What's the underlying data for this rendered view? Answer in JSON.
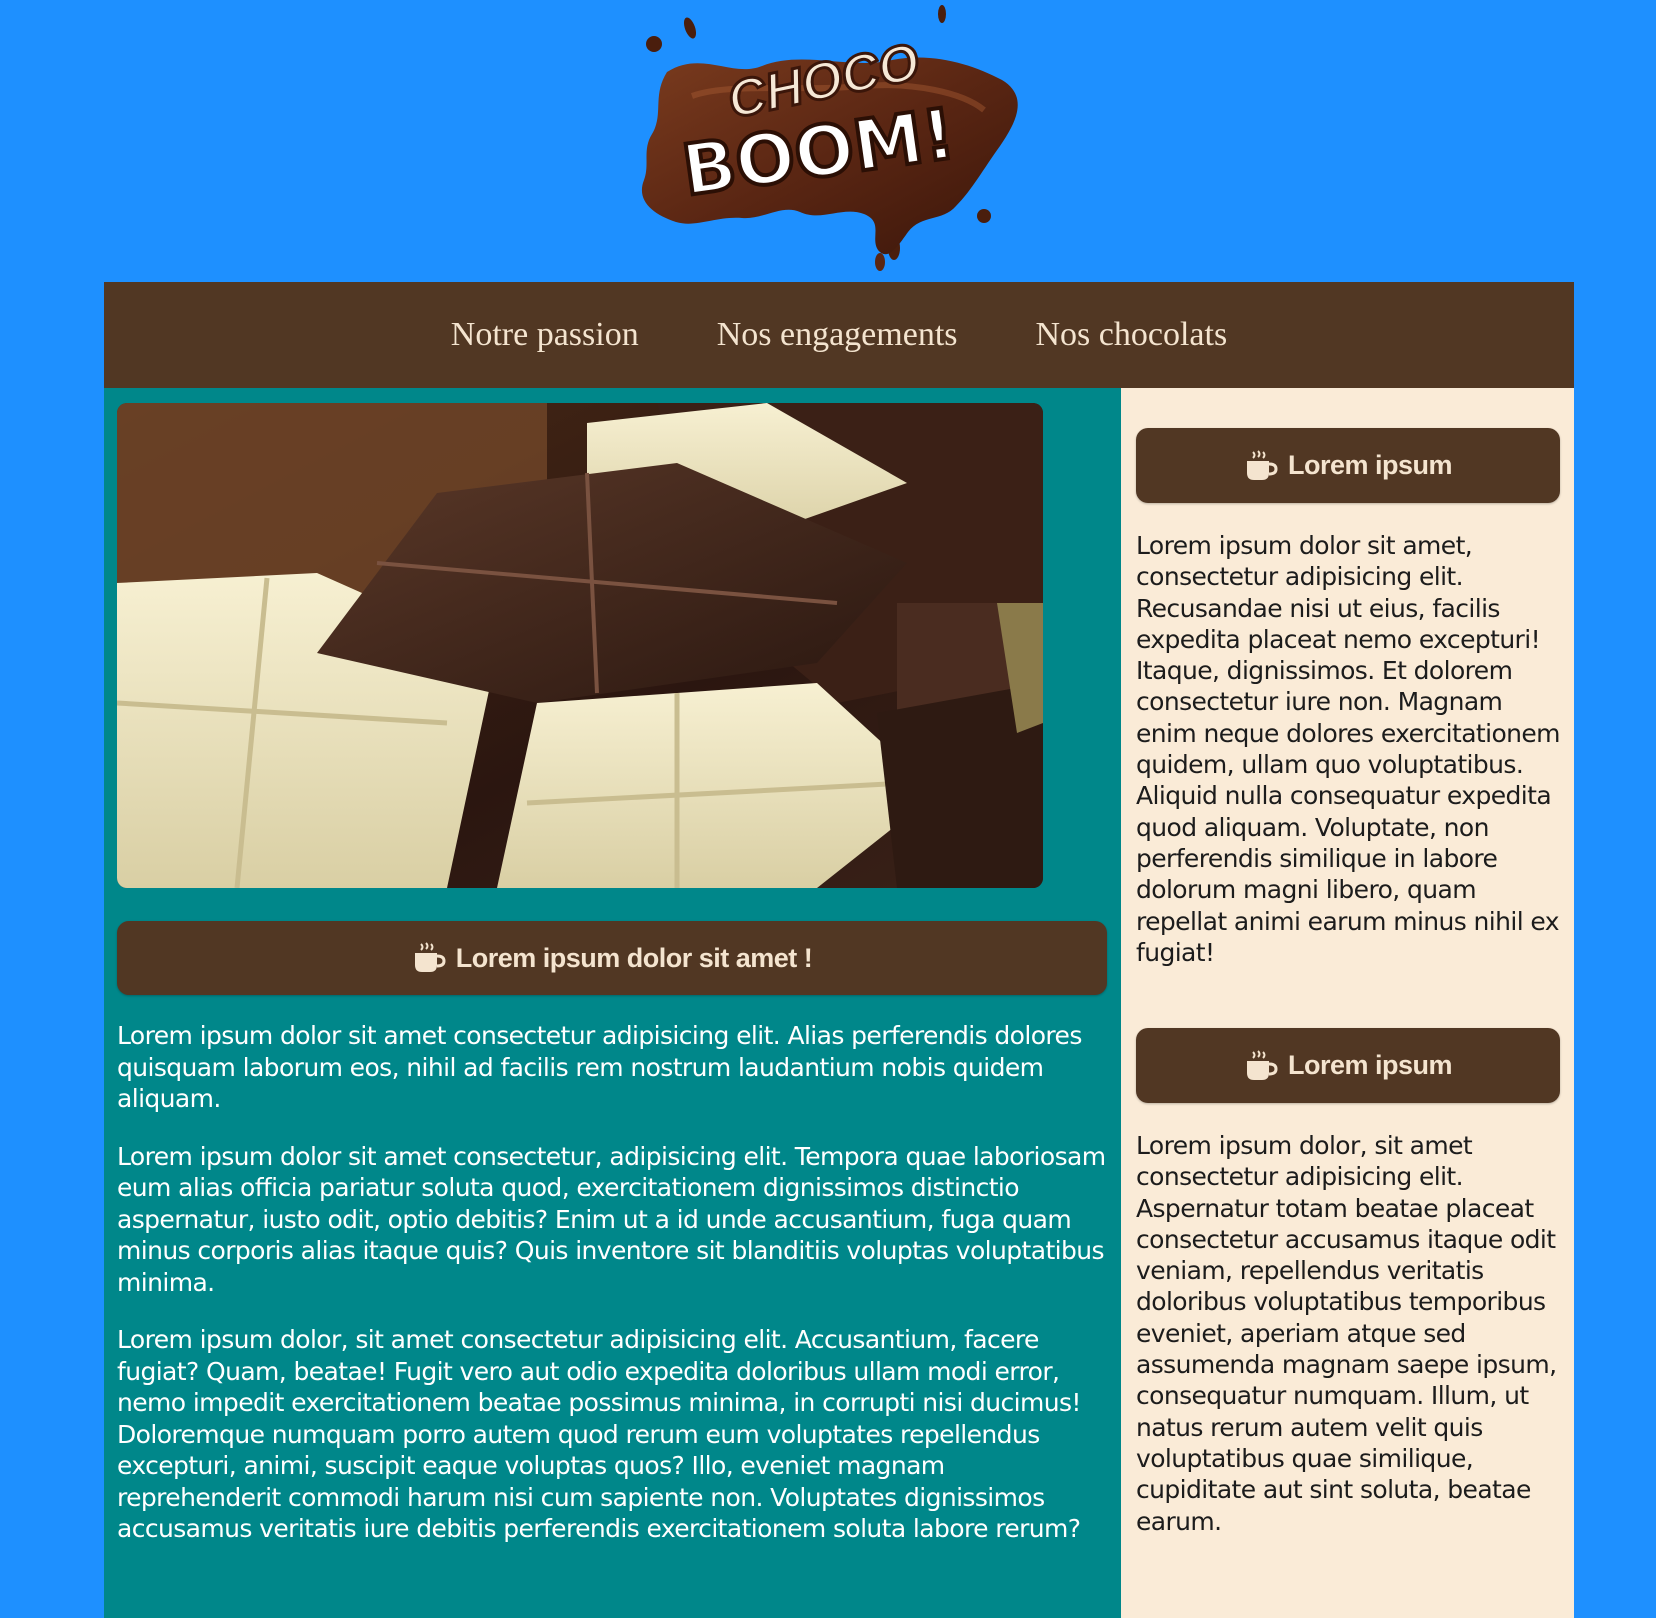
{
  "logo": {
    "line1": "CHOCO",
    "line2": "BOOM!"
  },
  "nav": {
    "items": [
      "Notre passion",
      "Nos engagements",
      "Nos chocolats"
    ]
  },
  "main": {
    "heading": "Lorem ipsum dolor sit amet !",
    "paragraphs": [
      "Lorem ipsum dolor sit amet consectetur adipisicing elit. Alias perferendis dolores quisquam laborum eos, nihil ad facilis rem nostrum laudantium nobis quidem aliquam.",
      "Lorem ipsum dolor sit amet consectetur, adipisicing elit. Tempora quae laboriosam eum alias officia pariatur soluta quod, exercitationem dignissimos distinctio aspernatur, iusto odit, optio debitis? Enim ut a id unde accusantium, fuga quam minus corporis alias itaque quis? Quis inventore sit blanditiis voluptas voluptatibus minima.",
      "Lorem ipsum dolor, sit amet consectetur adipisicing elit. Accusantium, facere fugiat? Quam, beatae! Fugit vero aut odio expedita doloribus ullam modi error, nemo impedit exercitationem beatae possimus minima, in corrupti nisi ducimus! Doloremque numquam porro autem quod rerum eum voluptates repellendus excepturi, animi, suscipit eaque voluptas quos? Illo, eveniet magnam reprehenderit commodi harum nisi cum sapiente non. Voluptates dignissimos accusamus veritatis iure debitis perferendis exercitationem soluta labore rerum?"
    ]
  },
  "aside": {
    "blocks": [
      {
        "heading": "Lorem ipsum",
        "text": "Lorem ipsum dolor sit amet, consectetur adipisicing elit. Recusandae nisi ut eius, facilis expedita placeat nemo excepturi! Itaque, dignissimos. Et dolorem consectetur iure non. Magnam enim neque dolores exercitationem quidem, ullam quo voluptatibus. Aliquid nulla consequatur expedita quod aliquam. Voluptate, non perferendis similique in labore dolorum magni libero, quam repellat animi earum minus nihil ex fugiat!"
      },
      {
        "heading": "Lorem ipsum",
        "text": "Lorem ipsum dolor, sit amet consectetur adipisicing elit. Aspernatur totam beatae placeat consectetur accusamus itaque odit veniam, repellendus veritatis doloribus voluptatibus temporibus eveniet, aperiam atque sed assumenda magnam saepe ipsum, consequatur numquam. Illum, ut natus rerum autem velit quis voluptatibus quae similique, cupiditate aut sint soluta, beatae earum."
      }
    ]
  },
  "icons": {
    "heading_icon": "coffee-cup-icon"
  },
  "colors": {
    "page_background": "#1e90ff",
    "nav_background": "#513723",
    "nav_text": "#f4e4cf",
    "main_background": "#00878a",
    "aside_background": "#faebd7",
    "heading_bar": "#513723"
  }
}
